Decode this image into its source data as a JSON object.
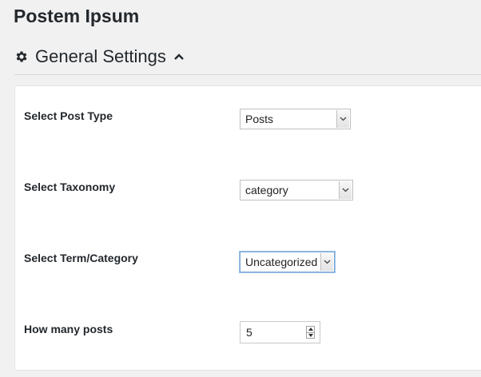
{
  "page": {
    "title": "Postem Ipsum"
  },
  "section": {
    "title": "General Settings",
    "icon": "gear-icon",
    "toggle_icon": "chevron-up-icon"
  },
  "settings": {
    "post_type": {
      "label": "Select Post Type",
      "value": "Posts"
    },
    "taxonomy": {
      "label": "Select Taxonomy",
      "value": "category"
    },
    "term": {
      "label": "Select Term/Category",
      "value": "Uncategorized"
    },
    "count": {
      "label": "How many posts",
      "value": "5"
    }
  },
  "colors": {
    "page_bg": "#f1f1f1",
    "panel_bg": "#ffffff",
    "text": "#23282d",
    "focus": "#7aa6d6"
  }
}
